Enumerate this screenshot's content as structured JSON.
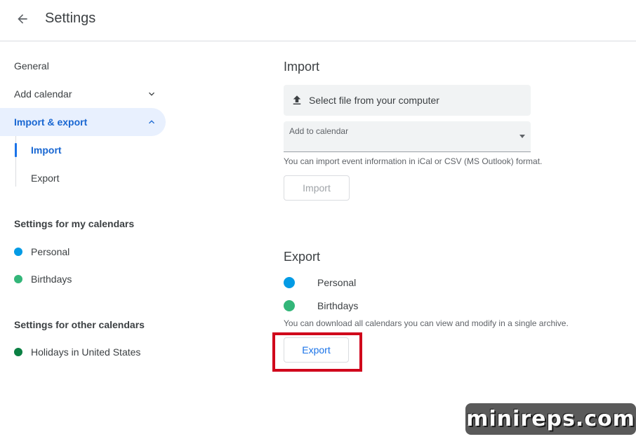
{
  "header": {
    "title": "Settings",
    "back_icon": "arrow-left-icon"
  },
  "sidebar": {
    "items": [
      {
        "label": "General"
      },
      {
        "label": "Add calendar",
        "icon": "chevron-down-icon"
      },
      {
        "label": "Import & export",
        "icon": "chevron-up-icon"
      }
    ],
    "sub_items": [
      {
        "label": "Import"
      },
      {
        "label": "Export"
      }
    ],
    "my_calendars_heading": "Settings for my calendars",
    "my_calendars": [
      {
        "label": "Personal",
        "color": "#039be5"
      },
      {
        "label": "Birthdays",
        "color": "#33b679"
      }
    ],
    "other_calendars_heading": "Settings for other calendars",
    "other_calendars": [
      {
        "label": "Holidays in United States",
        "color": "#0b8043"
      }
    ]
  },
  "import_section": {
    "heading": "Import",
    "file_select_label": "Select file from your computer",
    "file_select_icon": "upload-icon",
    "add_to_calendar_label": "Add to calendar",
    "hint": "You can import event information in iCal or CSV (MS Outlook) format.",
    "button_label": "Import"
  },
  "export_section": {
    "heading": "Export",
    "calendars": [
      {
        "label": "Personal",
        "color": "#039be5"
      },
      {
        "label": "Birthdays",
        "color": "#33b679"
      }
    ],
    "hint": "You can download all calendars you can view and modify in a single archive.",
    "button_label": "Export"
  },
  "colors": {
    "accent": "#1a73e8",
    "highlight": "#d0021b"
  },
  "watermark": {
    "text": "minireps.com"
  }
}
